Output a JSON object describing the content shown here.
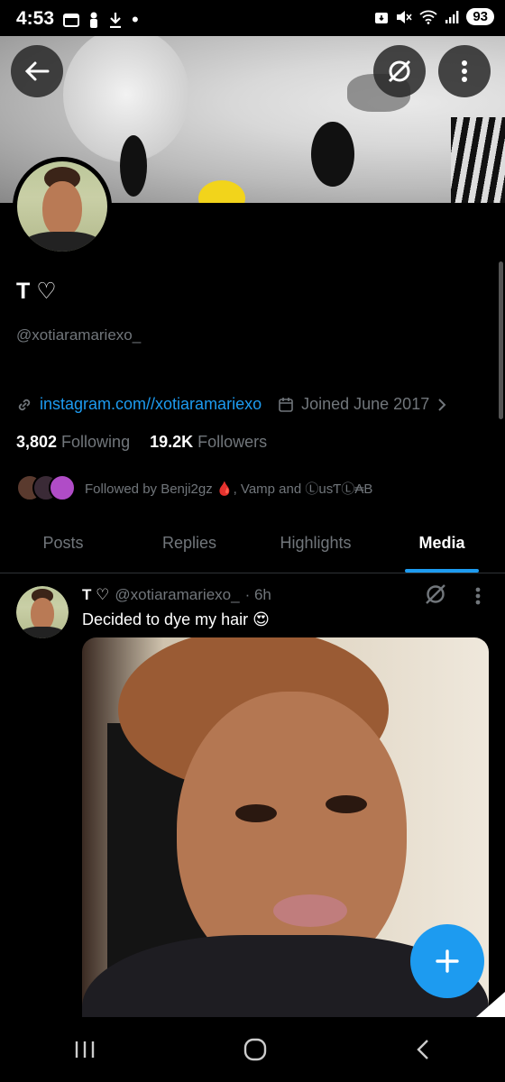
{
  "status_bar": {
    "time": "4:53",
    "battery": "93"
  },
  "profile": {
    "display_name": "T ♡",
    "handle": "@xotiaramariexo_",
    "website": "instagram.com//xotiaramariexo",
    "joined": "Joined June 2017",
    "following_count": "3,802",
    "following_label": "Following",
    "followers_count": "19.2K",
    "followers_label": "Followers",
    "followed_by": "Followed by Benji2gz 🩸, Vamp and ⓁusƬⓁ₳B"
  },
  "tabs": [
    {
      "label": "Posts"
    },
    {
      "label": "Replies"
    },
    {
      "label": "Highlights"
    },
    {
      "label": "Media"
    }
  ],
  "post": {
    "name": "T ♡",
    "handle": "@xotiaramariexo_",
    "time": "· 6h",
    "text": "Decided to dye my hair 😍"
  },
  "colors": {
    "accent": "#1d9bf0",
    "background": "#000000",
    "muted": "#71767b"
  }
}
